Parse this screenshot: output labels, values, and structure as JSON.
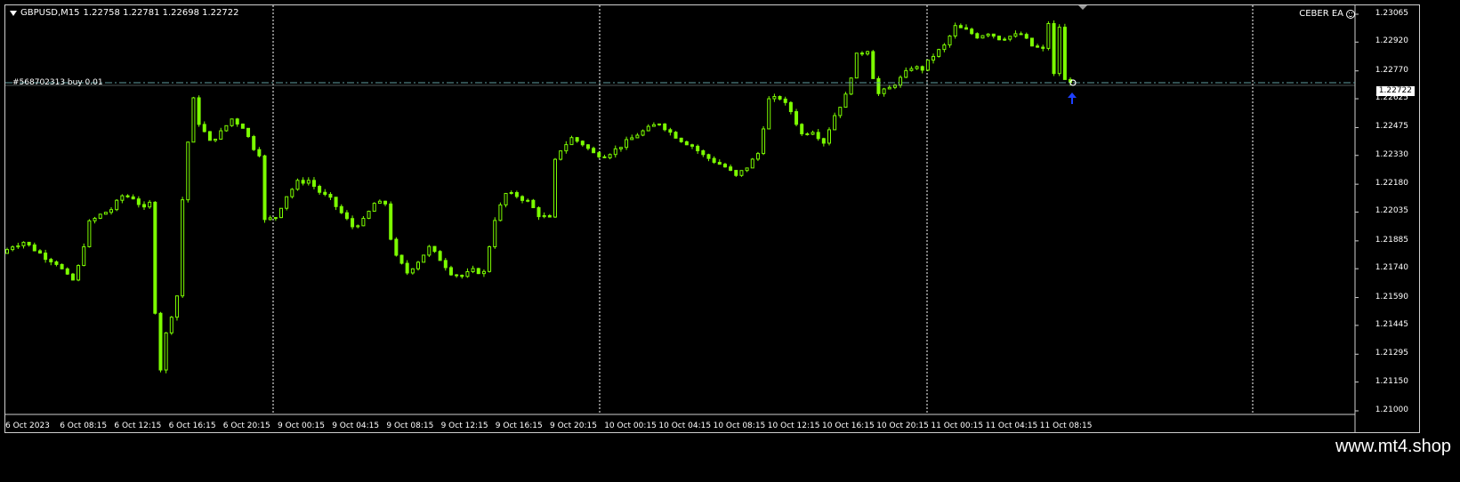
{
  "header": {
    "symbol": "GBPUSD,M15",
    "quotes": "1.22758 1.22781 1.22698 1.22722"
  },
  "expert": {
    "name": "CEBER EA"
  },
  "order": {
    "label": "#568702313 buy 0.01"
  },
  "current_price": "1.22722",
  "price_scale": [
    "1.23065",
    "1.22920",
    "1.22770",
    "1.22625",
    "1.22475",
    "1.22330",
    "1.22180",
    "1.22035",
    "1.21885",
    "1.21740",
    "1.21590",
    "1.21445",
    "1.21295",
    "1.21150",
    "1.21000"
  ],
  "time_scale": [
    "6 Oct 2023",
    "6 Oct 08:15",
    "6 Oct 12:15",
    "6 Oct 16:15",
    "6 Oct 20:15",
    "9 Oct 00:15",
    "9 Oct 04:15",
    "9 Oct 08:15",
    "9 Oct 12:15",
    "9 Oct 16:15",
    "9 Oct 20:15",
    "10 Oct 00:15",
    "10 Oct 04:15",
    "10 Oct 08:15",
    "10 Oct 12:15",
    "10 Oct 16:15",
    "10 Oct 20:15",
    "11 Oct 00:15",
    "11 Oct 04:15",
    "11 Oct 08:15"
  ],
  "colors": {
    "bull": "#7cfc00",
    "bear": "#7cfc00",
    "grid": "#ffffff",
    "order_line": "#5f9ea0",
    "arrow": "#1e40ff"
  },
  "watermark": "www.mt4.shop",
  "chart_data": {
    "type": "candlestick",
    "ylim": [
      1.21,
      1.23065
    ],
    "price_path": [
      [
        0,
        1.2182
      ],
      [
        2,
        1.2186
      ],
      [
        4,
        1.2188
      ],
      [
        6,
        1.2184
      ],
      [
        8,
        1.218
      ],
      [
        10,
        1.2177
      ],
      [
        12,
        1.217
      ],
      [
        13,
        1.2168
      ],
      [
        14,
        1.2175
      ],
      [
        16,
        1.2198
      ],
      [
        18,
        1.2202
      ],
      [
        20,
        1.2205
      ],
      [
        22,
        1.2212
      ],
      [
        24,
        1.2211
      ],
      [
        26,
        1.2205
      ],
      [
        27,
        1.2208
      ],
      [
        28,
        1.2152
      ],
      [
        29,
        1.2122
      ],
      [
        30,
        1.214
      ],
      [
        32,
        1.216
      ],
      [
        33,
        1.221
      ],
      [
        34,
        1.224
      ],
      [
        35,
        1.2262
      ],
      [
        36,
        1.225
      ],
      [
        38,
        1.224
      ],
      [
        40,
        1.2245
      ],
      [
        42,
        1.2252
      ],
      [
        44,
        1.2248
      ],
      [
        46,
        1.2237
      ],
      [
        47,
        1.2234
      ],
      [
        48,
        1.2199
      ],
      [
        50,
        1.2201
      ],
      [
        52,
        1.2212
      ],
      [
        54,
        1.2219
      ],
      [
        56,
        1.222
      ],
      [
        58,
        1.2214
      ],
      [
        60,
        1.221
      ],
      [
        62,
        1.2203
      ],
      [
        64,
        1.2196
      ],
      [
        66,
        1.2199
      ],
      [
        68,
        1.2208
      ],
      [
        70,
        1.2208
      ],
      [
        71,
        1.219
      ],
      [
        72,
        1.218
      ],
      [
        74,
        1.2172
      ],
      [
        76,
        1.2178
      ],
      [
        78,
        1.2185
      ],
      [
        80,
        1.2179
      ],
      [
        82,
        1.2172
      ],
      [
        84,
        1.217
      ],
      [
        86,
        1.2173
      ],
      [
        88,
        1.2172
      ],
      [
        90,
        1.22
      ],
      [
        92,
        1.2213
      ],
      [
        94,
        1.2212
      ],
      [
        96,
        1.2209
      ],
      [
        98,
        1.2202
      ],
      [
        100,
        1.22
      ],
      [
        101,
        1.223
      ],
      [
        102,
        1.2236
      ],
      [
        104,
        1.2242
      ],
      [
        106,
        1.2239
      ],
      [
        108,
        1.2234
      ],
      [
        110,
        1.2233
      ],
      [
        112,
        1.2236
      ],
      [
        114,
        1.224
      ],
      [
        116,
        1.2244
      ],
      [
        118,
        1.2247
      ],
      [
        120,
        1.225
      ],
      [
        122,
        1.2245
      ],
      [
        124,
        1.2241
      ],
      [
        126,
        1.2238
      ],
      [
        128,
        1.2233
      ],
      [
        130,
        1.223
      ],
      [
        132,
        1.2227
      ],
      [
        134,
        1.2222
      ],
      [
        136,
        1.2227
      ],
      [
        138,
        1.2234
      ],
      [
        140,
        1.2262
      ],
      [
        142,
        1.2263
      ],
      [
        144,
        1.2256
      ],
      [
        146,
        1.2244
      ],
      [
        148,
        1.2246
      ],
      [
        150,
        1.224
      ],
      [
        152,
        1.2254
      ],
      [
        154,
        1.2264
      ],
      [
        156,
        1.2285
      ],
      [
        158,
        1.2288
      ],
      [
        159,
        1.2274
      ],
      [
        160,
        1.2265
      ],
      [
        162,
        1.2268
      ],
      [
        164,
        1.2273
      ],
      [
        166,
        1.2279
      ],
      [
        168,
        1.2278
      ],
      [
        170,
        1.2285
      ],
      [
        172,
        1.229
      ],
      [
        174,
        1.23
      ],
      [
        176,
        1.2298
      ],
      [
        178,
        1.2295
      ],
      [
        180,
        1.2297
      ],
      [
        182,
        1.2294
      ],
      [
        184,
        1.2295
      ],
      [
        186,
        1.2296
      ],
      [
        188,
        1.229
      ],
      [
        190,
        1.2288
      ],
      [
        191,
        1.2302
      ],
      [
        192,
        1.2275
      ],
      [
        193,
        1.23
      ],
      [
        194,
        1.2272
      ]
    ],
    "seed": 7
  }
}
